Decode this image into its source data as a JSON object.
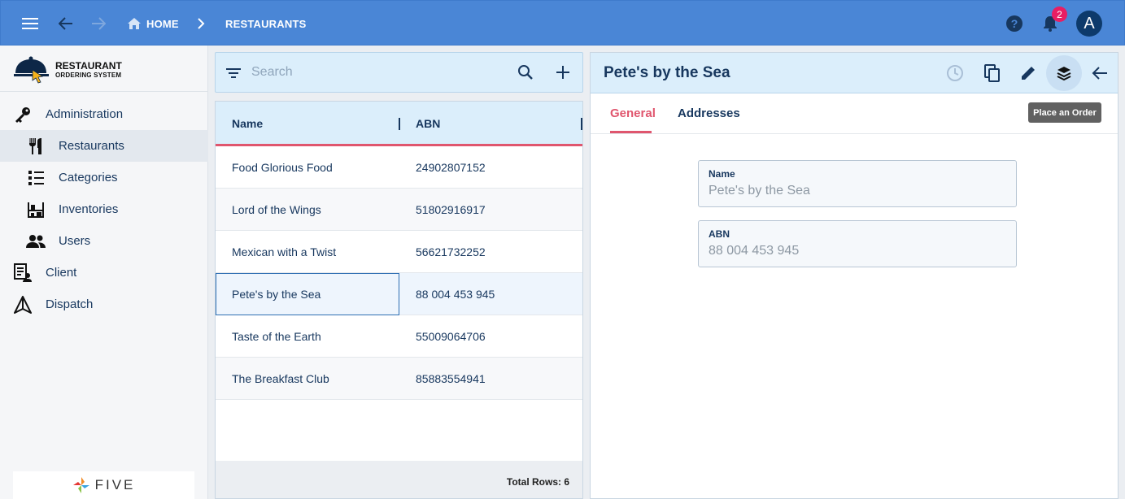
{
  "topbar": {
    "breadcrumb_home": "HOME",
    "breadcrumb_current": "RESTAURANTS",
    "notification_count": "2",
    "avatar_initial": "A"
  },
  "sidebar": {
    "logo_line1": "RESTAURANT",
    "logo_line2": "ORDERING SYSTEM",
    "items": [
      {
        "label": "Administration",
        "icon": "key-icon"
      },
      {
        "label": "Restaurants",
        "icon": "fork-knife-icon"
      },
      {
        "label": "Categories",
        "icon": "list-icon"
      },
      {
        "label": "Inventories",
        "icon": "shelves-icon"
      },
      {
        "label": "Users",
        "icon": "people-icon"
      },
      {
        "label": "Client",
        "icon": "client-icon"
      },
      {
        "label": "Dispatch",
        "icon": "dispatch-icon"
      }
    ],
    "brand": "FIVE"
  },
  "list": {
    "search_placeholder": "Search",
    "columns": [
      "Name",
      "ABN"
    ],
    "rows": [
      {
        "name": "Food Glorious Food",
        "abn": "24902807152"
      },
      {
        "name": "Lord of the Wings",
        "abn": "51802916917"
      },
      {
        "name": "Mexican with a Twist",
        "abn": "56621732252"
      },
      {
        "name": "Pete's by the Sea",
        "abn": "88 004 453 945"
      },
      {
        "name": "Taste of the Earth",
        "abn": "55009064706"
      },
      {
        "name": "The Breakfast Club",
        "abn": "85883554941"
      }
    ],
    "footer": "Total Rows: 6"
  },
  "detail": {
    "title": "Pete's by the Sea",
    "tooltip": "Place an Order",
    "tabs": [
      "General",
      "Addresses"
    ],
    "fields": [
      {
        "label": "Name",
        "value": "Pete's by the Sea"
      },
      {
        "label": "ABN",
        "value": "88 004 453 945"
      }
    ]
  },
  "colors": {
    "topbar": "#4a86d6",
    "accent": "#e0566e",
    "navy": "#17375e",
    "panel_header": "#dbeefb"
  }
}
